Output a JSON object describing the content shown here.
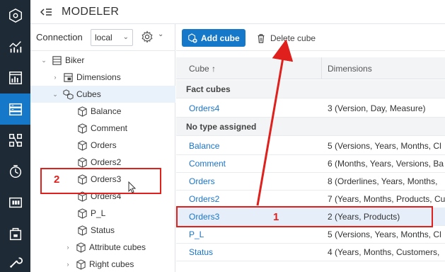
{
  "header": {
    "title": "MODELER"
  },
  "rail": {
    "items": [
      "hexagon-icon",
      "analytics-icon",
      "reports-icon",
      "modeler-icon",
      "hierarchy-icon",
      "scheduler-icon",
      "monitor-icon",
      "package-icon",
      "tools-icon"
    ],
    "active_index": 3
  },
  "connection": {
    "label": "Connection",
    "value": "local"
  },
  "tree": {
    "root": "Biker",
    "dimensions": "Dimensions",
    "cubes": "Cubes",
    "cube_items": [
      "Balance",
      "Comment",
      "Orders",
      "Orders2",
      "Orders3",
      "Orders4",
      "P_L",
      "Status"
    ],
    "attribute_cubes": "Attribute cubes",
    "right_cubes": "Right cubes"
  },
  "toolbar": {
    "add_label": "Add cube",
    "delete_label": "Delete cube"
  },
  "table": {
    "col_cube": "Cube ↑",
    "col_dimensions": "Dimensions",
    "group_fact": "Fact cubes",
    "group_none": "No type assigned",
    "fact_rows": [
      {
        "name": "Orders4",
        "dims": "3 (Version, Day, Measure)"
      }
    ],
    "rows": [
      {
        "name": "Balance",
        "dims": "5 (Versions, Years, Months, Cl"
      },
      {
        "name": "Comment",
        "dims": "6 (Months, Years, Versions, Ba"
      },
      {
        "name": "Orders",
        "dims": "8 (Orderlines, Years, Months, "
      },
      {
        "name": "Orders2",
        "dims": "7 (Years, Months, Products, Cu"
      },
      {
        "name": "Orders3",
        "dims": "2 (Years, Products)"
      },
      {
        "name": "P_L",
        "dims": "5 (Versions, Years, Months, Cl"
      },
      {
        "name": "Status",
        "dims": "4 (Years, Months, Customers, "
      }
    ]
  },
  "annotations": {
    "label_1": "1",
    "label_2": "2"
  },
  "colors": {
    "accent": "#1678c8",
    "rail": "#1e2a36",
    "annotation": "#e0201c"
  }
}
